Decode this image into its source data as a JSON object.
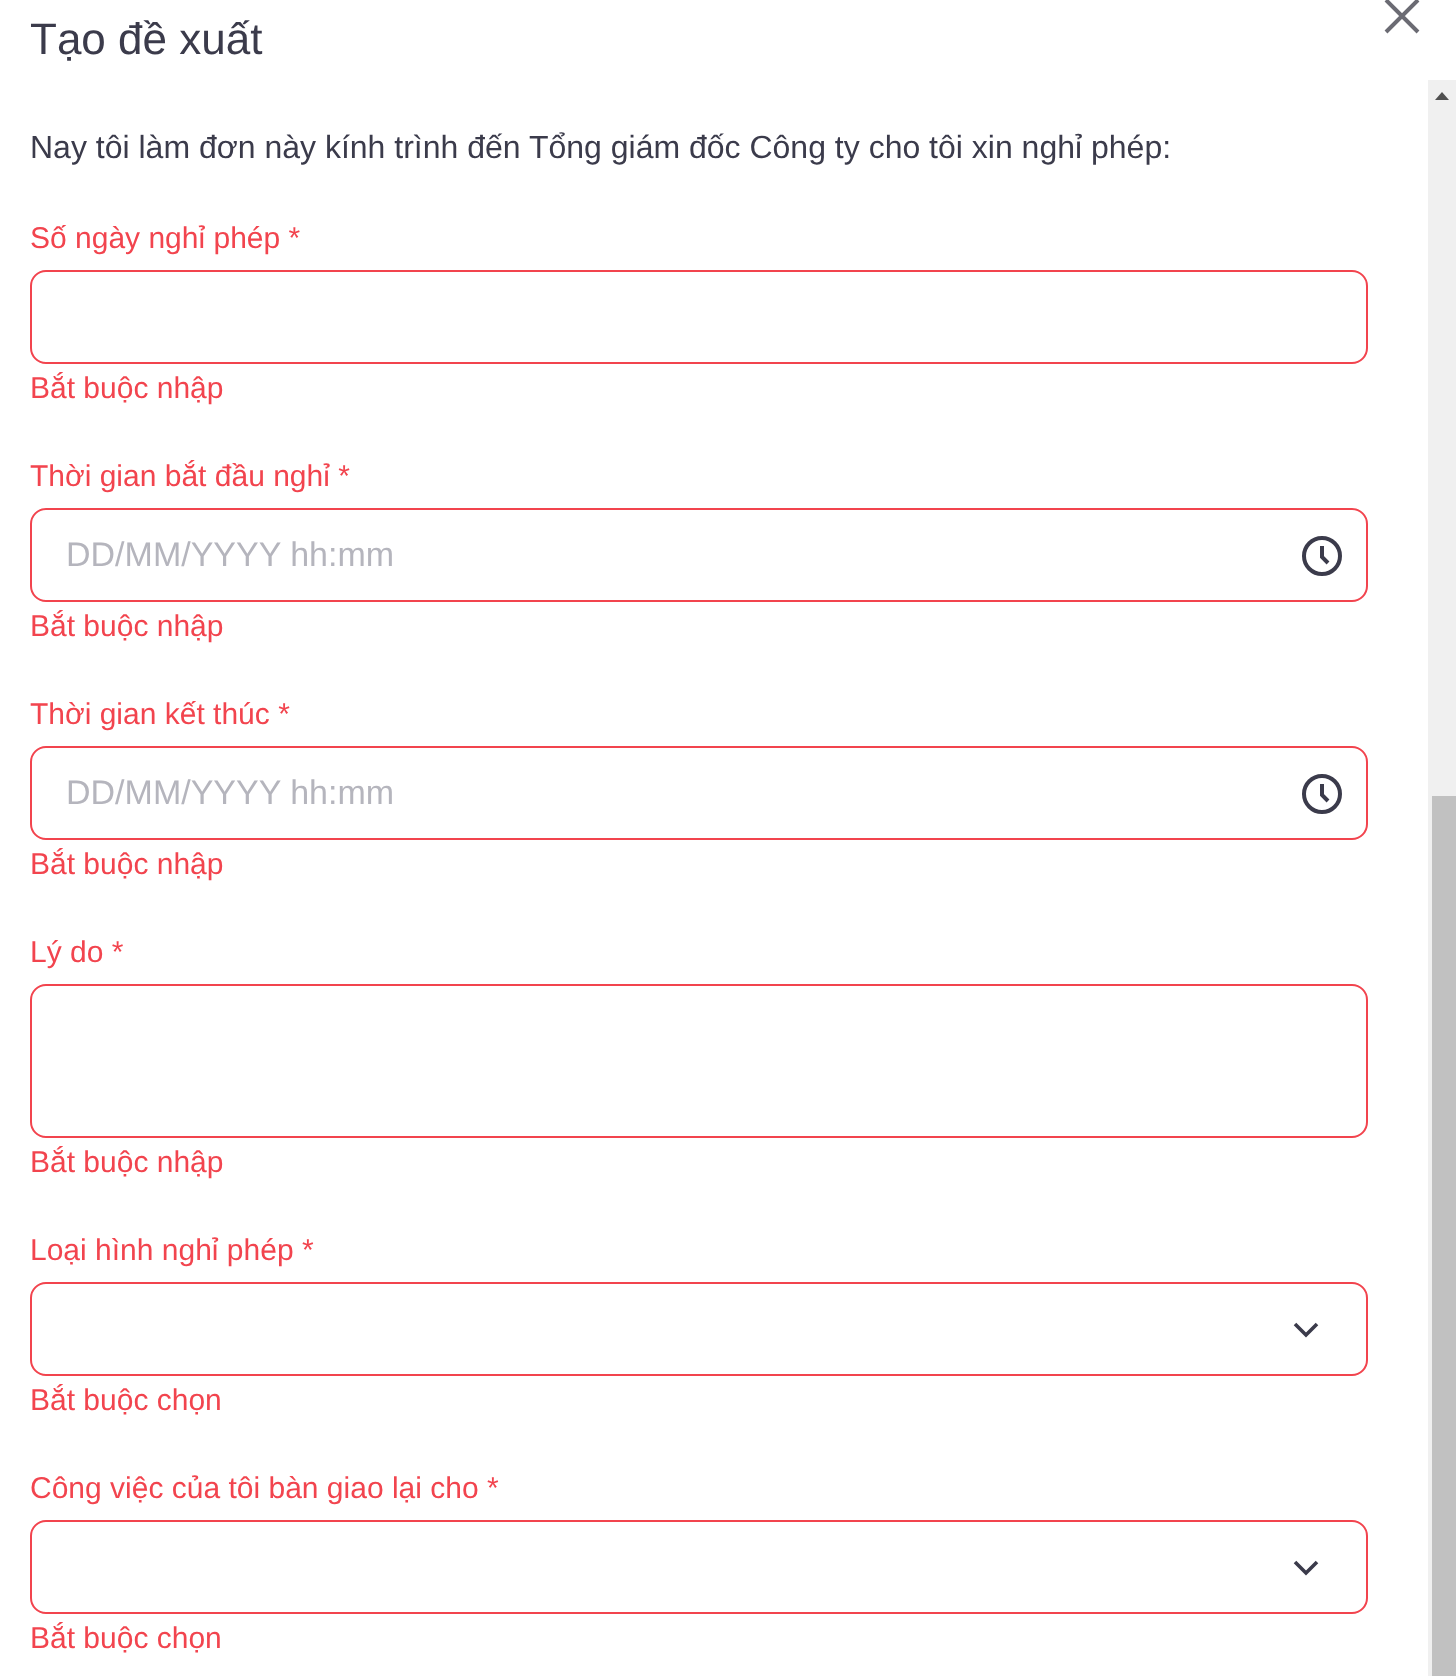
{
  "dialog": {
    "title": "Tạo đề xuất",
    "intro": "Nay tôi làm đơn này kính trình đến Tổng giám đốc Công ty cho tôi xin nghỉ phép:"
  },
  "fields": [
    {
      "kind": "text",
      "label": "Số ngày nghỉ phép *",
      "invalid": true,
      "error": "Bắt buộc nhập"
    },
    {
      "kind": "datetime",
      "label": "Thời gian bắt đầu nghỉ *",
      "placeholder": "DD/MM/YYYY hh:mm",
      "invalid": true,
      "error": "Bắt buộc nhập"
    },
    {
      "kind": "datetime",
      "label": "Thời gian kết thúc *",
      "placeholder": "DD/MM/YYYY hh:mm",
      "invalid": true,
      "error": "Bắt buộc nhập"
    },
    {
      "kind": "textarea",
      "label": "Lý do *",
      "invalid": true,
      "error": "Bắt buộc nhập"
    },
    {
      "kind": "select",
      "label": "Loại hình nghỉ phép *",
      "invalid": true,
      "error": "Bắt buộc chọn"
    },
    {
      "kind": "select",
      "label": "Công việc của tôi bàn giao lại cho *",
      "invalid": true,
      "error": "Bắt buộc chọn"
    }
  ]
}
